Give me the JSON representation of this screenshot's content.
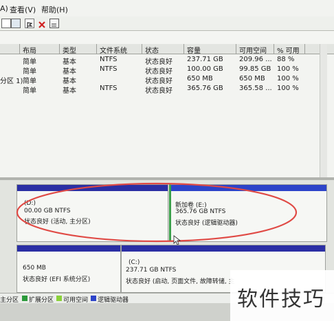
{
  "menu": {
    "action_partial": "A)",
    "view": "查看(V)",
    "help": "帮助(H)"
  },
  "toolbar": {
    "icons": [
      "help-icon",
      "view-icon",
      "flag-icon",
      "delete-icon",
      "properties-icon"
    ]
  },
  "table": {
    "columns": [
      "布局",
      "类型",
      "文件系统",
      "状态",
      "容量",
      "可用空间",
      "% 可用"
    ],
    "rows": [
      {
        "volume": "",
        "layout": "简单",
        "type": "基本",
        "fs": "NTFS",
        "status": "状态良好",
        "capacity": "237.71 GB",
        "free": "209.96 ...",
        "pct": "88 %"
      },
      {
        "volume": "",
        "layout": "简单",
        "type": "基本",
        "fs": "NTFS",
        "status": "状态良好",
        "capacity": "100.00 GB",
        "free": "99.85 GB",
        "pct": "100 %"
      },
      {
        "volume": "分区 1)",
        "layout": "简单",
        "type": "基本",
        "fs": "",
        "status": "状态良好",
        "capacity": "650 MB",
        "free": "650 MB",
        "pct": "100 %"
      },
      {
        "volume": "",
        "layout": "简单",
        "type": "基本",
        "fs": "NTFS",
        "status": "状态良好",
        "capacity": "365.76 GB",
        "free": "365.58 ...",
        "pct": "100 %"
      }
    ]
  },
  "disk1": {
    "part1": {
      "name": "(D:)",
      "size": "00.00 GB NTFS",
      "status": "状态良好 (活动, 主分区)"
    },
    "part2": {
      "name": "新加卷 (E:)",
      "size": "365.76 GB NTFS",
      "status": "状态良好 (逻辑驱动器)"
    }
  },
  "disk0": {
    "part1": {
      "name": "",
      "size": "650 MB",
      "status": "状态良好 (EFI 系统分区)"
    },
    "part2": {
      "name": "(C:)",
      "size": "237.71 GB NTFS",
      "status": "状态良好 (启动, 页面文件, 故障转储, 主"
    }
  },
  "legend": {
    "items": [
      {
        "label": "主分区",
        "color": "#2b2fa4"
      },
      {
        "label": "扩展分区",
        "color": "#2b9a3a"
      },
      {
        "label": "可用空间",
        "color": "#8ad13a"
      },
      {
        "label": "逻辑驱动器",
        "color": "#2d44c9"
      }
    ]
  },
  "watermark": {
    "text": "软件技巧"
  },
  "colors": {
    "primary_bar": "#2b2fa4",
    "selection_outline": "#e04a45",
    "extended_border": "#3aa04a"
  }
}
